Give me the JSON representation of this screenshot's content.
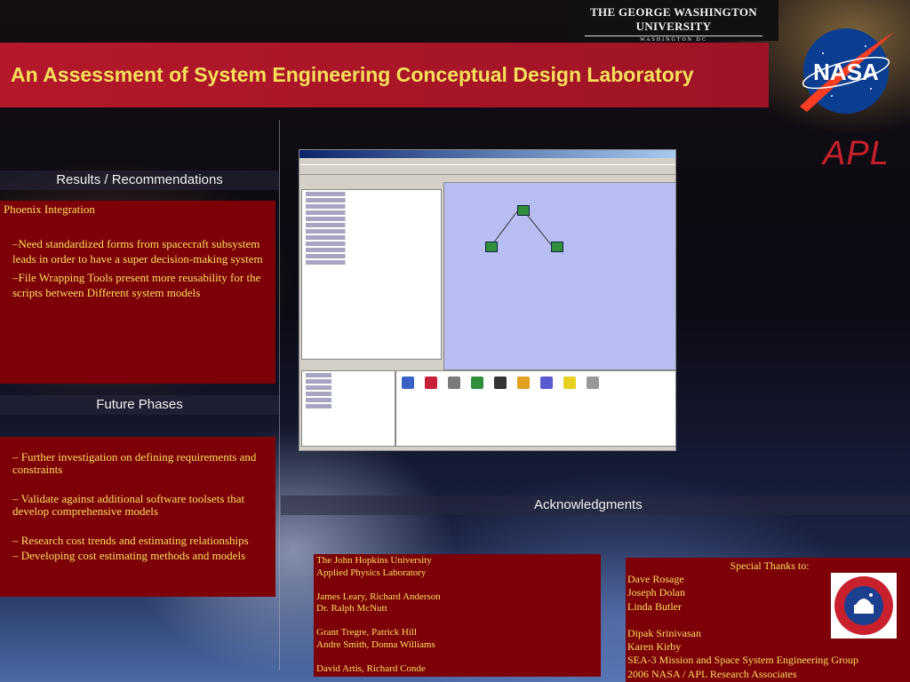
{
  "header": {
    "university": "THE GEORGE WASHINGTON UNIVERSITY",
    "university_sub": "WASHINGTON DC",
    "title": "An Assessment of System Engineering Conceptual Design Laboratory",
    "apl_logo": "APL",
    "nasa_logo": "NASA"
  },
  "results": {
    "heading": "Results / Recommendations",
    "org": "Phoenix Integration",
    "items": [
      "–Need standardized forms from spacecraft subsystem leads in order to have a super decision-making system",
      "–File Wrapping Tools present more reusability for the scripts between Different system models"
    ]
  },
  "future": {
    "heading": "Future Phases",
    "items": [
      "– Further investigation on defining requirements and constraints",
      "– Validate against additional software toolsets that develop comprehensive models",
      "– Research cost trends and estimating relationships",
      "– Developing cost estimating methods and models"
    ]
  },
  "acknowledgments": {
    "heading": "Acknowledgments",
    "left_lines": [
      "The John Hopkins University",
      "Applied Physics Laboratory",
      "",
      "James Leary, Richard Anderson",
      "Dr. Ralph McNutt",
      "",
      "Grant Tregre, Patrick Hill",
      "Andre Smith, Donna Williams",
      "",
      "David Artis, Richard Conde"
    ],
    "thanks_title": "Special Thanks to:",
    "right_lines": [
      "Dave Rosage",
      "Joseph Dolan",
      "Linda Butler",
      "",
      "Dipak Srinivasan",
      "Karen Kirby",
      "SEA-3 Mission and Space System Engineering Group",
      "2006 NASA / APL Research Associates"
    ]
  },
  "colors": {
    "title_bar": "#b4182a",
    "title_text": "#f6e05a",
    "box_red": "#7d0008",
    "box_text": "#f6e05a"
  }
}
